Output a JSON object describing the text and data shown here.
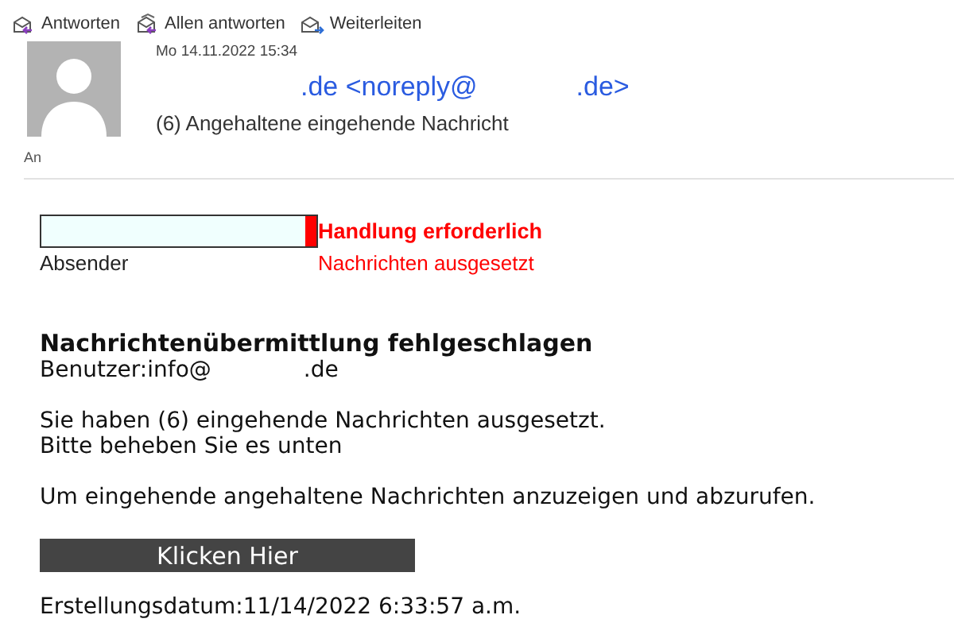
{
  "toolbar": [
    {
      "label": "Antworten",
      "kind": "reply"
    },
    {
      "label": "Allen antworten",
      "kind": "reply-all"
    },
    {
      "label": "Weiterleiten",
      "kind": "forward"
    }
  ],
  "header": {
    "date": "Mo 14.11.2022 15:34",
    "sender_parts": [
      ".de <noreply@",
      ".de>"
    ],
    "subject": "(6) Angehaltene eingehende Nachricht",
    "to_label": "An"
  },
  "body": {
    "alert_title": "Handlung erforderlich",
    "bar_label": "Absender",
    "alert_subtitle": "Nachrichten ausgesetzt",
    "heading": "Nachrichtenübermittlung fehlgeschlagen",
    "user_parts": [
      "Benutzer:info@",
      ".de"
    ],
    "paragraphs": [
      [
        "Sie haben (6) eingehende Nachrichten ausgesetzt.",
        "Bitte beheben Sie es unten"
      ],
      [
        "Um eingehende angehaltene Nachrichten anzuzeigen und abzurufen."
      ]
    ],
    "button": "Klicken Hier",
    "created": "Erstellungsdatum:11/14/2022 6:33:57 a.m."
  }
}
